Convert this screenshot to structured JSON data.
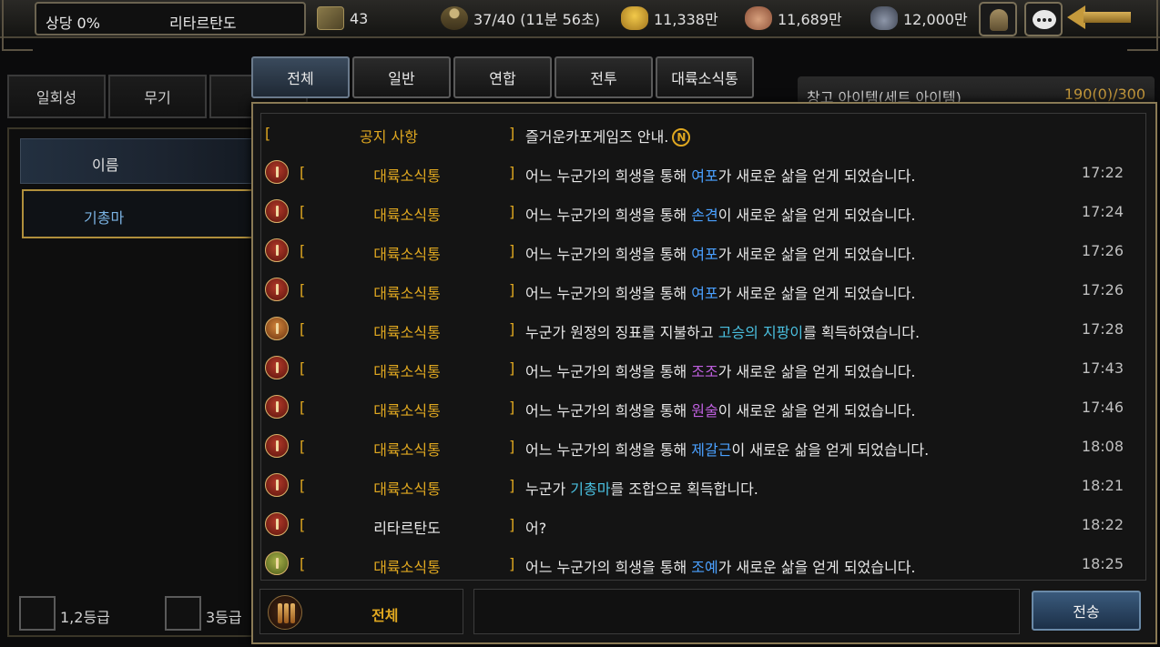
{
  "top": {
    "trade_label": "상당 0%",
    "city_name": "리타르탄도",
    "scrolls": "43",
    "troops": "37/40 (11분 56초)",
    "gold": "11,338만",
    "food": "11,689만",
    "ore": "12,000만"
  },
  "bg": {
    "tabs": [
      "일회성",
      "무기",
      ""
    ],
    "list_header": "이름",
    "selected_item": "기총마",
    "grade1": "1,2등급",
    "grade2": "3등급",
    "storage_title": "창고 아이템(세트 아이템)",
    "storage_count": "190(0)/300"
  },
  "chat": {
    "tabs": [
      "전체",
      "일반",
      "연합",
      "전투",
      "대륙소식통"
    ],
    "active_tab": 0,
    "messages": [
      {
        "badge": "none",
        "channel": "공지 사항",
        "pre": "즐거운카포게임즈 안내.",
        "hl": "",
        "post": "",
        "time": "",
        "notice": true
      },
      {
        "badge": "red",
        "channel": "대륙소식통",
        "pre": "어느 누군가의 희생을 통해 ",
        "hl": "여포",
        "hlcolor": "blue",
        "post": "가 새로운 삶을 얻게 되었습니다.",
        "time": "17:22"
      },
      {
        "badge": "red",
        "channel": "대륙소식통",
        "pre": "어느 누군가의 희생을 통해 ",
        "hl": "손견",
        "hlcolor": "blue",
        "post": "이 새로운 삶을 얻게 되었습니다.",
        "time": "17:24"
      },
      {
        "badge": "red",
        "channel": "대륙소식통",
        "pre": "어느 누군가의 희생을 통해 ",
        "hl": "여포",
        "hlcolor": "blue",
        "post": "가 새로운 삶을 얻게 되었습니다.",
        "time": "17:26"
      },
      {
        "badge": "red",
        "channel": "대륙소식통",
        "pre": "어느 누군가의 희생을 통해 ",
        "hl": "여포",
        "hlcolor": "blue",
        "post": "가 새로운 삶을 얻게 되었습니다.",
        "time": "17:26"
      },
      {
        "badge": "orange",
        "channel": "대륙소식통",
        "pre": "누군가 원정의 징표를 지불하고 ",
        "hl": "고승의 지팡이",
        "hlcolor": "cyan",
        "post": "를 획득하였습니다.",
        "time": "17:28"
      },
      {
        "badge": "red",
        "channel": "대륙소식통",
        "pre": "어느 누군가의 희생을 통해 ",
        "hl": "조조",
        "hlcolor": "purple",
        "post": "가 새로운 삶을 얻게 되었습니다.",
        "time": "17:43"
      },
      {
        "badge": "red",
        "channel": "대륙소식통",
        "pre": "어느 누군가의 희생을 통해 ",
        "hl": "원술",
        "hlcolor": "purple",
        "post": "이 새로운 삶을 얻게 되었습니다.",
        "time": "17:46"
      },
      {
        "badge": "red",
        "channel": "대륙소식통",
        "pre": "어느 누군가의 희생을 통해 ",
        "hl": "제갈근",
        "hlcolor": "blue",
        "post": "이 새로운 삶을 얻게 되었습니다.",
        "time": "18:08"
      },
      {
        "badge": "red",
        "channel": "대륙소식통",
        "pre": "누군가 ",
        "hl": "기총마",
        "hlcolor": "cyan",
        "post": "를 조합으로 획득합니다.",
        "time": "18:21"
      },
      {
        "badge": "red",
        "channel": "리타르탄도",
        "channel_white": true,
        "pre": "어?",
        "hl": "",
        "post": "",
        "time": "18:22"
      },
      {
        "badge": "green",
        "channel": "대륙소식통",
        "pre": "어느 누군가의 희생을 통해 ",
        "hl": "조예",
        "hlcolor": "blue",
        "post": "가 새로운 삶을 얻게 되었습니다.",
        "time": "18:25"
      }
    ],
    "notice_badge": "N",
    "bracket_open": "[",
    "bracket_close": "]",
    "footer_channel": "전체",
    "input_placeholder": "",
    "send_label": "전송"
  }
}
